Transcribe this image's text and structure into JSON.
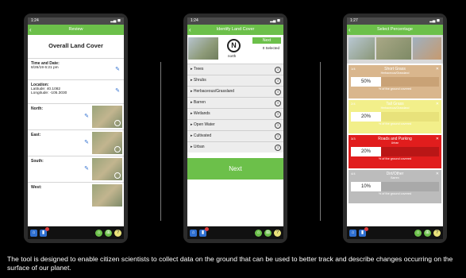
{
  "phone1": {
    "time": "1:24",
    "title": "Review",
    "heading": "Overall Land Cover",
    "time_label": "Time and Date:",
    "time_value": "8/26/19 6:21 pm",
    "location_label": "Location:",
    "latitude": "Latitude: 40.1082",
    "longitude": "Longitude: -105.3030",
    "directions": [
      "North:",
      "East:",
      "South:",
      "West:"
    ]
  },
  "phone2": {
    "time": "1:24",
    "title": "Identify Land Cover",
    "compass_letter": "N",
    "compass_label": "north",
    "next_small": "Next",
    "selected": "0 Selected",
    "categories": [
      "Trees",
      "Shrubs",
      "Herbaceous/Grassland",
      "Barren",
      "Wetlands",
      "Open Water",
      "Cultivated",
      "Urban"
    ],
    "next_big": "Next"
  },
  "phone3": {
    "time": "1:27",
    "title": "Select Percentage",
    "cards": [
      {
        "num": "1/4",
        "title": "Short Grass",
        "subtitle": "Herbaceous/Grassland",
        "value": "50%",
        "footer": "% of the ground covered",
        "bg": "#d9b68d",
        "bar": "#c9a276"
      },
      {
        "num": "2/4",
        "title": "Tall Grass",
        "subtitle": "Herbaceous/Grassland",
        "value": "20%",
        "footer": "% of the ground covered",
        "bg": "#f2ef8a",
        "bar": "#e8e27b"
      },
      {
        "num": "3/3",
        "title": "Roads and Parking",
        "subtitle": "Urban",
        "value": "20%",
        "footer": "% of the ground covered",
        "bg": "#e11d1d",
        "bar": "#b91616"
      },
      {
        "num": "4/4",
        "title": "Dirt/Other",
        "subtitle": "Barren",
        "value": "10%",
        "footer": "% of the ground covered",
        "bg": "#bcbcbc",
        "bar": "#a9a9a9"
      }
    ]
  },
  "caption": "The tool is designed to enable citizen scientists to collect data on the ground that can be used to better track and describe changes occurring on the surface of our planet.",
  "colors": {
    "accent": "#6cc04a",
    "blue": "#2f6fd0",
    "background": "#000000"
  }
}
